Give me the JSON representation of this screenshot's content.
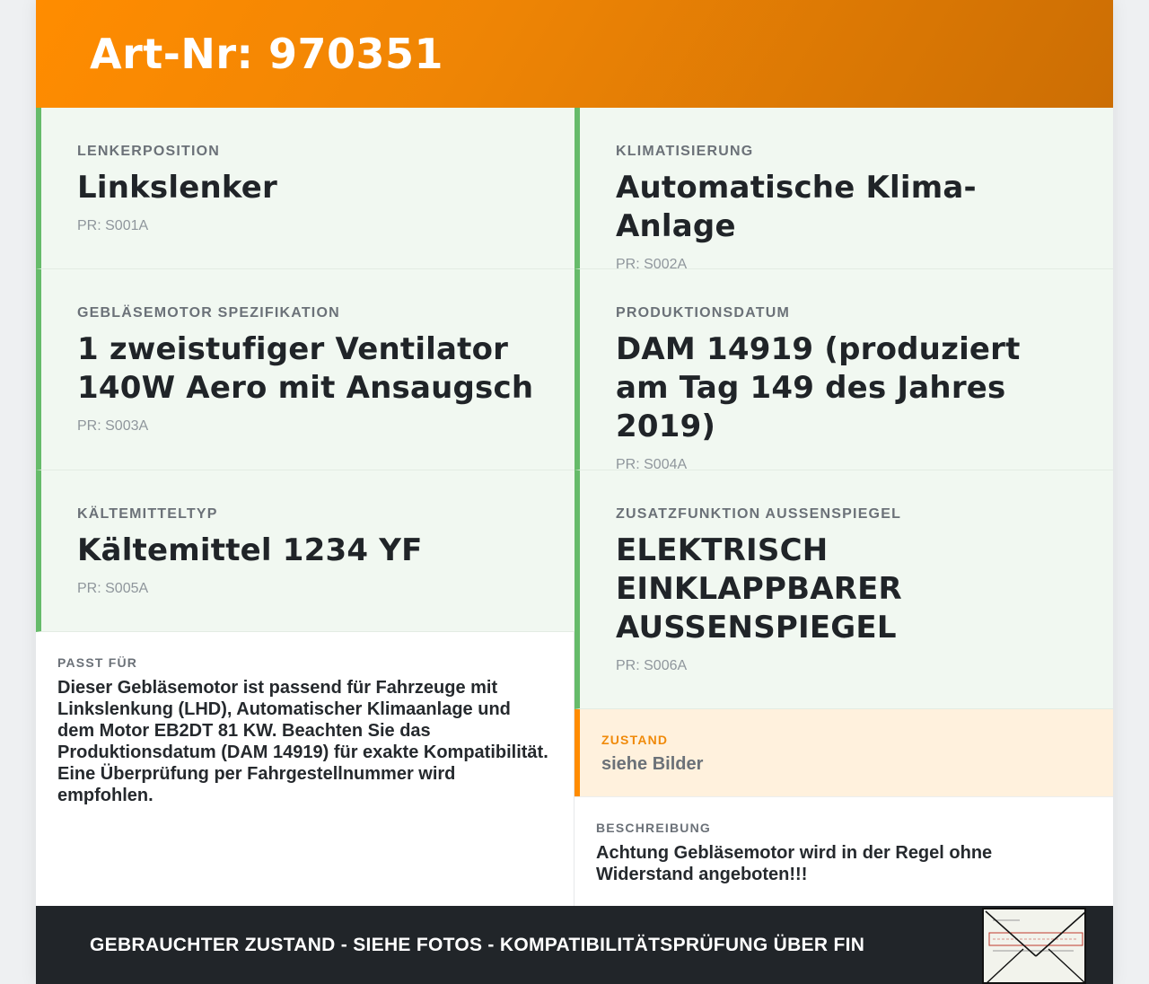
{
  "header": {
    "title": "Art-Nr: 970351"
  },
  "specs": [
    {
      "label": "LENKERPOSITION",
      "value": "Linkslenker",
      "code": "PR: S001A"
    },
    {
      "label": "KLIMATISIERUNG",
      "value": "Automatische Klima-Anlage",
      "code": "PR: S002A"
    },
    {
      "label": "GEBLÄSEMOTOR SPEZIFIKATION",
      "value": "1 zweistufiger Ventilator 140W Aero mit Ansaugsch",
      "code": "PR: S003A"
    },
    {
      "label": "PRODUKTIONSDATUM",
      "value": "DAM 14919 (produziert am Tag 149 des Jahres 2019)",
      "code": "PR: S004A"
    },
    {
      "label": "KÄLTEMITTELTYP",
      "value": "Kältemittel 1234 YF",
      "code": "PR: S005A"
    },
    {
      "label": "ZUSATZFUNKTION AUSSENSPIEGEL",
      "value": "ELEKTRISCH EINKLAPPBARER AUSSENSPIEGEL",
      "code": "PR: S006A"
    }
  ],
  "fits": {
    "label": "PASST FÜR",
    "text": "Dieser Gebläsemotor ist passend für Fahrzeuge mit Linkslenkung (LHD), Automatischer Klimaanlage und dem Motor EB2DT 81 KW. Beachten Sie das Produktionsdatum (DAM 14919) für exakte Kompatibilität. Eine Überprüfung per Fahrgestellnummer wird empfohlen."
  },
  "state": {
    "label": "ZUSTAND",
    "value": "siehe Bilder"
  },
  "description": {
    "label": "BESCHREIBUNG",
    "text": "Achtung Gebläsemotor wird in der Regel ohne Widerstand angeboten!!!"
  },
  "footer": {
    "text": "GEBRAUCHTER ZUSTAND - SIEHE FOTOS - KOMPATIBILITÄTSPRÜFUNG ÜBER FIN",
    "thumbnail_text": "Mercedes-Benz"
  },
  "colors": {
    "header_accent": "#ff8c00",
    "spec_border": "#66bb6a",
    "spec_bg": "#f1f8f1",
    "state_bg": "#fff1dd",
    "footer_bg": "#212529"
  }
}
